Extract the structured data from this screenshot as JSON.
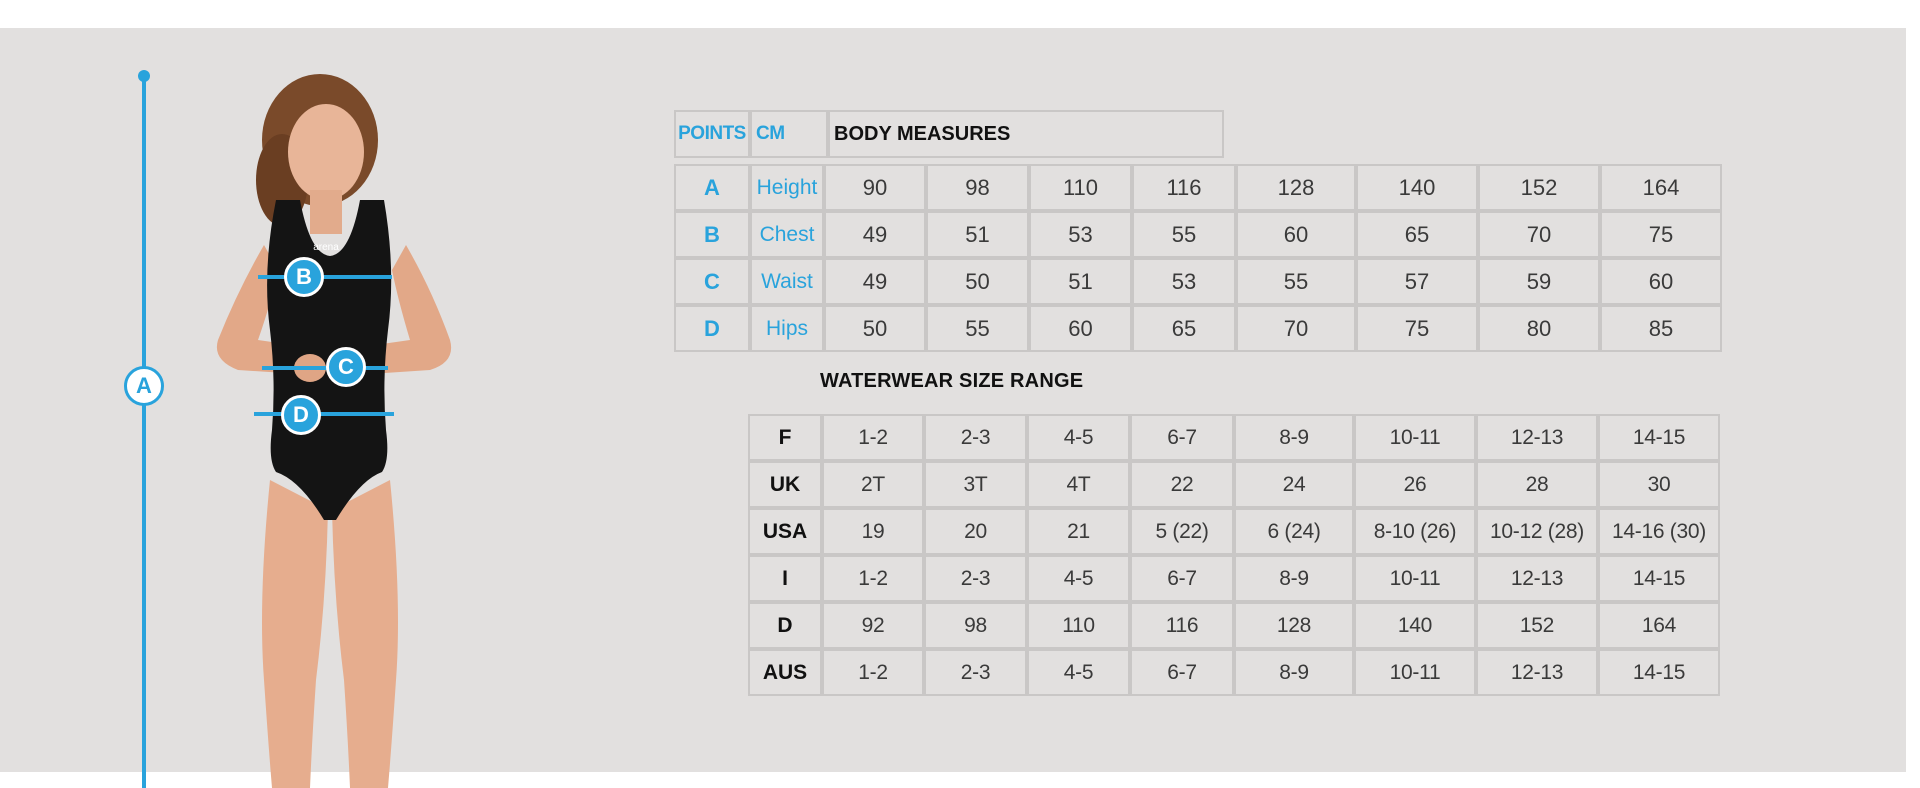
{
  "colors": {
    "accent": "#29a3dc",
    "panel": "#e2e0df",
    "grid": "#c9c7c6"
  },
  "figure": {
    "markers": {
      "a": "A",
      "b": "B",
      "c": "C",
      "d": "D"
    },
    "logo_text": "arena"
  },
  "body_measures": {
    "headers": {
      "points": "POINTS",
      "cm": "CM",
      "title": "BODY MEASURES"
    },
    "rows": [
      {
        "point": "A",
        "label": "Height",
        "values": [
          "90",
          "98",
          "110",
          "116",
          "128",
          "140",
          "152",
          "164"
        ]
      },
      {
        "point": "B",
        "label": "Chest",
        "values": [
          "49",
          "51",
          "53",
          "55",
          "60",
          "65",
          "70",
          "75"
        ]
      },
      {
        "point": "C",
        "label": "Waist",
        "values": [
          "49",
          "50",
          "51",
          "53",
          "55",
          "57",
          "59",
          "60"
        ]
      },
      {
        "point": "D",
        "label": "Hips",
        "values": [
          "50",
          "55",
          "60",
          "65",
          "70",
          "75",
          "80",
          "85"
        ]
      }
    ]
  },
  "size_range": {
    "title": "WATERWEAR SIZE RANGE",
    "rows": [
      {
        "region": "F",
        "values": [
          "1-2",
          "2-3",
          "4-5",
          "6-7",
          "8-9",
          "10-11",
          "12-13",
          "14-15"
        ]
      },
      {
        "region": "UK",
        "values": [
          "2T",
          "3T",
          "4T",
          "22",
          "24",
          "26",
          "28",
          "30"
        ]
      },
      {
        "region": "USA",
        "values": [
          "19",
          "20",
          "21",
          "5 (22)",
          "6 (24)",
          "8-10 (26)",
          "10-12 (28)",
          "14-16 (30)"
        ]
      },
      {
        "region": "I",
        "values": [
          "1-2",
          "2-3",
          "4-5",
          "6-7",
          "8-9",
          "10-11",
          "12-13",
          "14-15"
        ]
      },
      {
        "region": "D",
        "values": [
          "92",
          "98",
          "110",
          "116",
          "128",
          "140",
          "152",
          "164"
        ]
      },
      {
        "region": "AUS",
        "values": [
          "1-2",
          "2-3",
          "4-5",
          "6-7",
          "8-9",
          "10-11",
          "12-13",
          "14-15"
        ]
      }
    ]
  }
}
